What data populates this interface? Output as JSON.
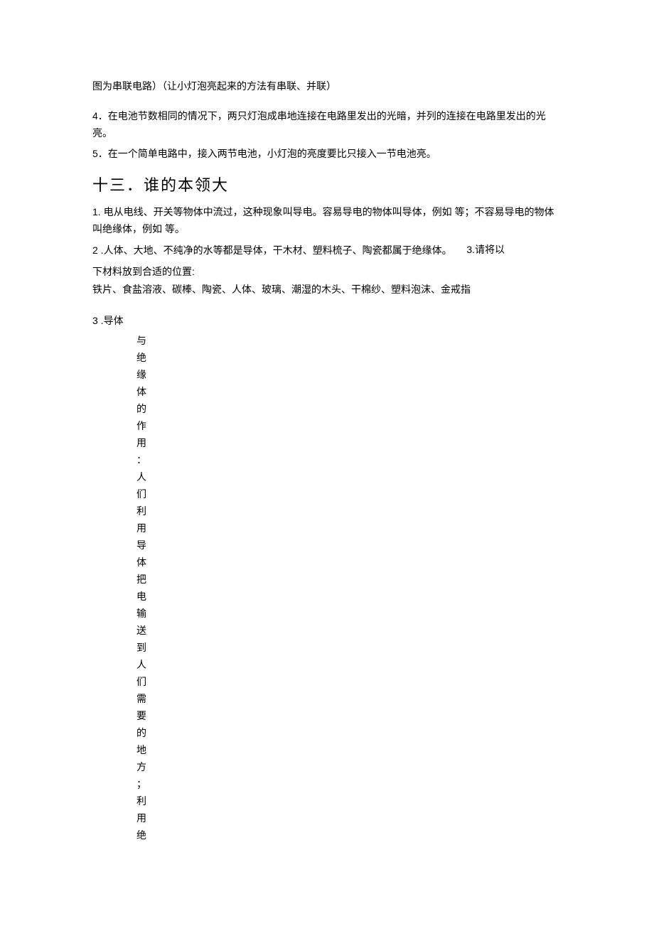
{
  "top_note": "图为串联电路）（让小灯泡亮起来的方法有串联、并联）",
  "item4": "4．在电池节数相同的情况下，两只灯泡成串地连接在电路里发出的光暗，并列的连接在电路里发出的光亮。",
  "item4_line2": "",
  "item5": "5．在一个简单电路中，接入两节电池，小灯泡的亮度要比只接入一节电池亮。",
  "heading13": "十三．谁的本领大",
  "s13_item1": "1. 电从电线、开关等物体中流过，这种现象叫导电。容易导电的物体叫导体，例如 等；不容易导电的物体叫绝缘体，例如  等。",
  "s13_item2": "2 .人体、大地、不纯净的水等都是导体，干木材、塑料梳子、陶瓷都属于绝缘体。",
  "s13_item3_right": "3.请将以",
  "s13_item3_cont": "下材料放到合适的位置:",
  "s13_materials": "铁片、食盐溶液、碳棒、陶瓷、人体、玻璃、潮湿的木头、干棉纱、塑料泡沫、金戒指",
  "s13_vertical_lead": "3 .导体",
  "s13_vertical_chars": [
    "与",
    "绝",
    "缘",
    "体",
    "的",
    "作",
    "用",
    "：",
    "人",
    "们",
    "利",
    "用",
    "导",
    "体",
    "把",
    "电",
    "输",
    "送",
    "到",
    "人",
    "们",
    "需",
    "要",
    "的",
    "地",
    "方",
    "；",
    "利",
    "用",
    "绝"
  ]
}
